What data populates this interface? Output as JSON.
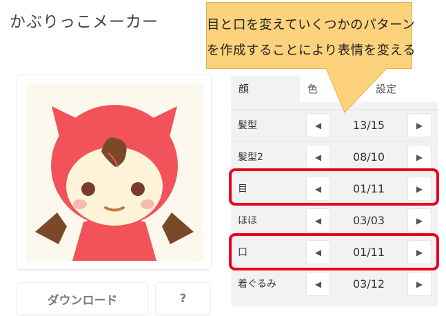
{
  "app": {
    "title": "かぶりっこメーカー"
  },
  "callout": {
    "line1": "目と口を変えていくつかのパターン",
    "line2": "を作成することにより表情を変える",
    "fill_color": "#fdd27c"
  },
  "tabs": [
    {
      "label": "顔",
      "active": true
    },
    {
      "label": "色",
      "active": false
    },
    {
      "label": "設定",
      "active": false
    }
  ],
  "rows": [
    {
      "label": "髪型",
      "value": "13/15",
      "highlighted": false
    },
    {
      "label": "髪型2",
      "value": "08/10",
      "highlighted": false
    },
    {
      "label": "目",
      "value": "01/11",
      "highlighted": true
    },
    {
      "label": "ほほ",
      "value": "03/03",
      "highlighted": false
    },
    {
      "label": "口",
      "value": "01/11",
      "highlighted": true
    },
    {
      "label": "着ぐるみ",
      "value": "03/12",
      "highlighted": false
    }
  ],
  "arrows": {
    "prev": "◀",
    "next": "▶"
  },
  "buttons": {
    "download": "ダウンロード",
    "help": "?"
  },
  "colors": {
    "hood": "#f2525a",
    "hair": "#7a4a28",
    "face": "#fef4da",
    "highlight": "#e8001c"
  },
  "icons": [
    "chevron-left-icon",
    "chevron-right-icon"
  ]
}
